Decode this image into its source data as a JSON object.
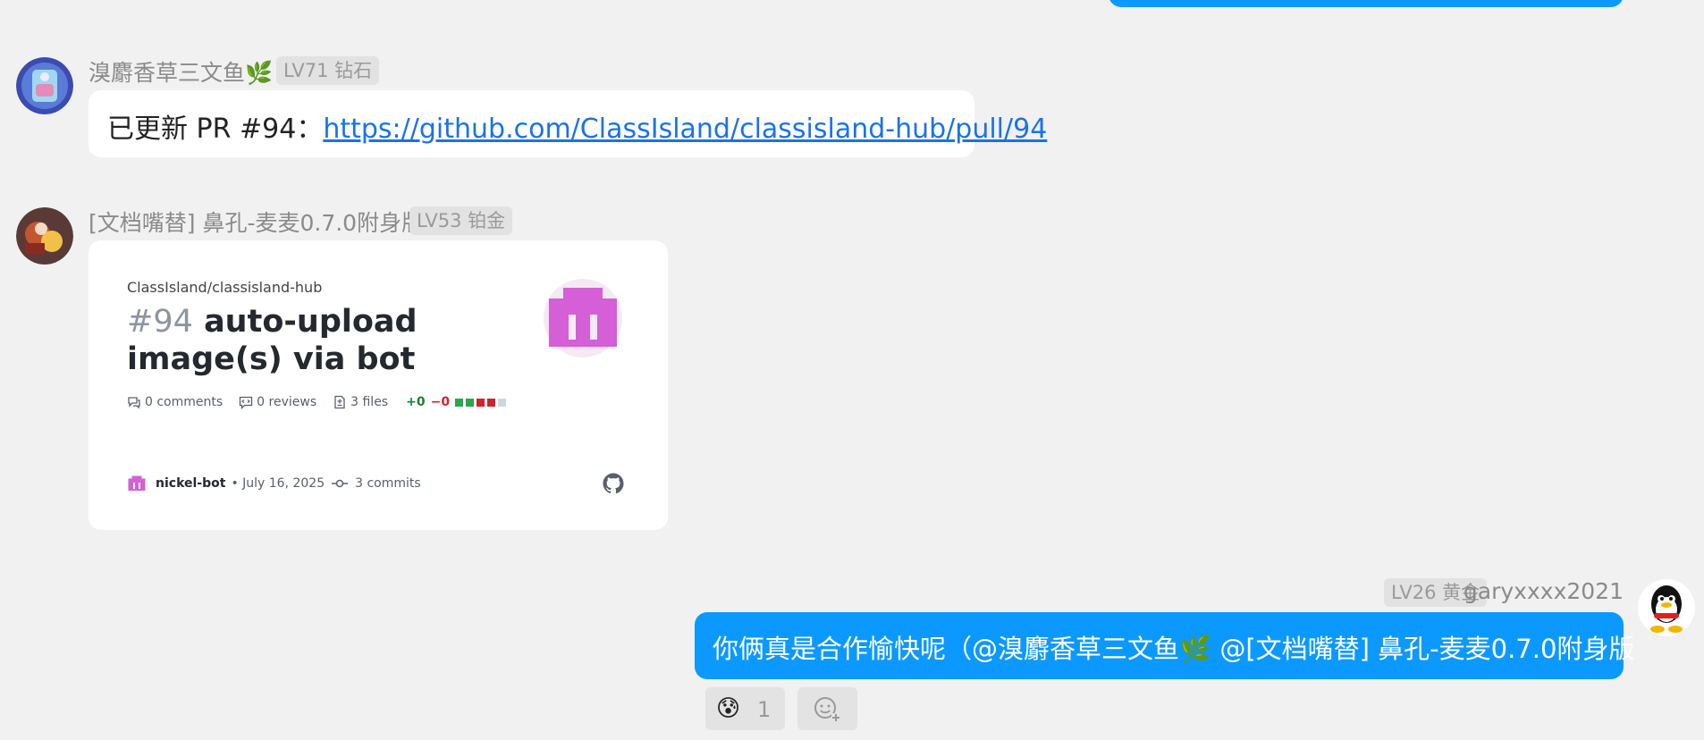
{
  "messages": [
    {
      "username": "溴麝香草三文鱼🌿",
      "level": "LV71 钻石",
      "text_prefix": "已更新 PR #94：",
      "link": "https://github.com/ClassIsland/classisland-hub/pull/94"
    },
    {
      "username": "[文档嘴替] 鼻孔-麦麦0.7.0附身版",
      "level": "LV53 铂金",
      "card": {
        "repo": "ClassIsland/classisland-hub",
        "number": "#94",
        "title": "auto-upload image(s) via bot",
        "comments": "0 comments",
        "reviews": "0 reviews",
        "files": "3 files",
        "additions": "+0",
        "deletions": "−0",
        "author": "nickel-bot",
        "date": "• July 16, 2025",
        "commits": "3 commits"
      }
    },
    {
      "username": "garyxxxx2021",
      "level": "LV26 黄金",
      "text": "你俩真是合作愉快呢（@溴麝香草三文鱼🌿 @[文档嘴替] 鼻孔-麦麦0.7.0附身版",
      "reactions": [
        {
          "emoji": "😰",
          "count": "1"
        }
      ]
    }
  ],
  "icons": {
    "comment": "comment-icon",
    "review": "review-icon",
    "file": "file-diff-icon",
    "commit": "commit-icon",
    "github": "github-icon",
    "add_reaction": "add-reaction-icon"
  },
  "colors": {
    "accent_blue": "#0b99ff",
    "link": "#1a73e8",
    "bot_pink": "#d45fd6",
    "addition_green": "#1a7f37",
    "deletion_red": "#cf222e"
  }
}
